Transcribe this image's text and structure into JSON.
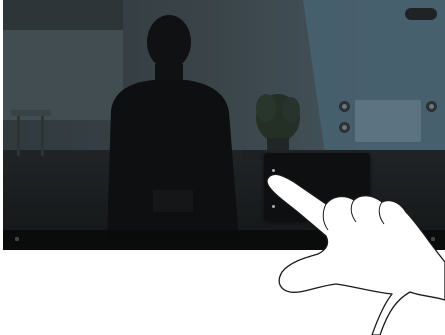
{
  "top_pill": "",
  "popup": {
    "title": "",
    "items": [
      {
        "label": "",
        "selected": true
      },
      {
        "label": ""
      },
      {
        "label": ""
      }
    ],
    "tab_label": ""
  },
  "toolbar": {
    "items": [
      {
        "label": ""
      },
      {
        "label": ""
      },
      {
        "label": ""
      },
      {
        "label": ""
      }
    ]
  },
  "colors": {
    "screen_bg": "#15181a",
    "wall_light": "#8a9ea8",
    "hand_outline": "#1a1a1a",
    "hand_fill": "#ffffff"
  },
  "icons": {
    "left_sidebar": "dot-icon",
    "right_sidebar": "dot-icon",
    "toolbar_edges": "square-icon"
  }
}
